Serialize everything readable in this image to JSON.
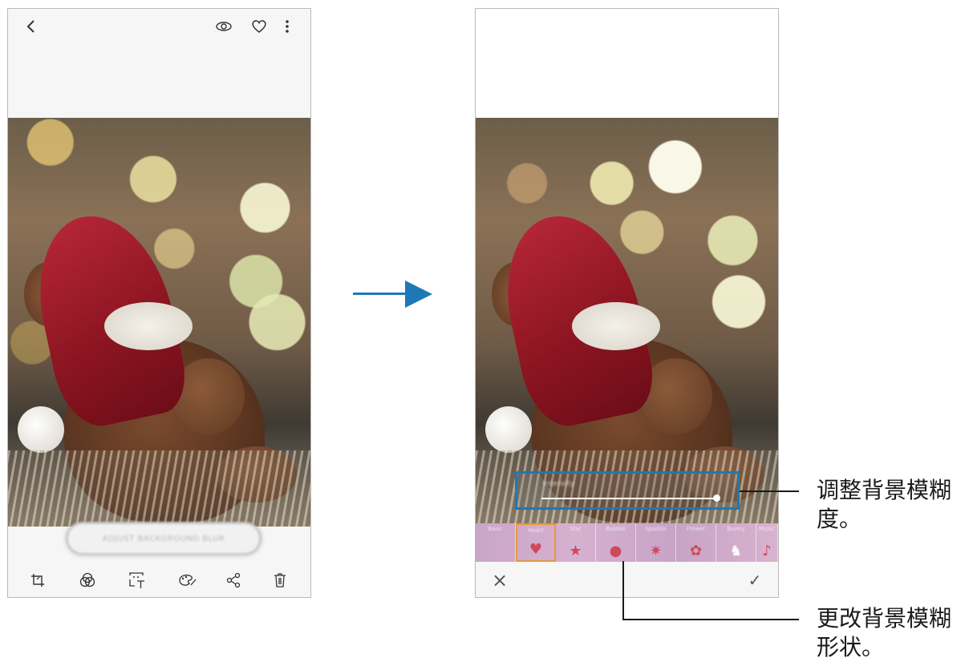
{
  "left_phone": {
    "top_icons": {
      "back": "<",
      "view": "eye-icon",
      "favorite": "heart-icon",
      "more": "⋮"
    },
    "button_label": "ADJUST BACKGROUND BLUR",
    "bottom_icons": [
      "crop-icon",
      "filter-icon",
      "text-icon",
      "paint-icon",
      "share-icon",
      "trash-icon"
    ]
  },
  "right_phone": {
    "slider_label": "Intensity",
    "shape_tiles": [
      {
        "name": "Basic",
        "glyph": ""
      },
      {
        "name": "Heart",
        "glyph": "♥",
        "selected": true
      },
      {
        "name": "Star",
        "glyph": "★"
      },
      {
        "name": "Bubble",
        "glyph": "●"
      },
      {
        "name": "Sparkle",
        "glyph": "✷"
      },
      {
        "name": "Flower",
        "glyph": "✿"
      },
      {
        "name": "Bunny",
        "glyph": "♞"
      },
      {
        "name": "Music",
        "glyph": "♪"
      }
    ],
    "cancel_label": "×",
    "apply_label": "✓"
  },
  "annotations": {
    "adjust": "调整背景模糊\n度。",
    "shape": "更改背景模糊\n形状。"
  },
  "colors": {
    "accent": "#1e78b6",
    "selected_tile": "#e59a3a"
  }
}
